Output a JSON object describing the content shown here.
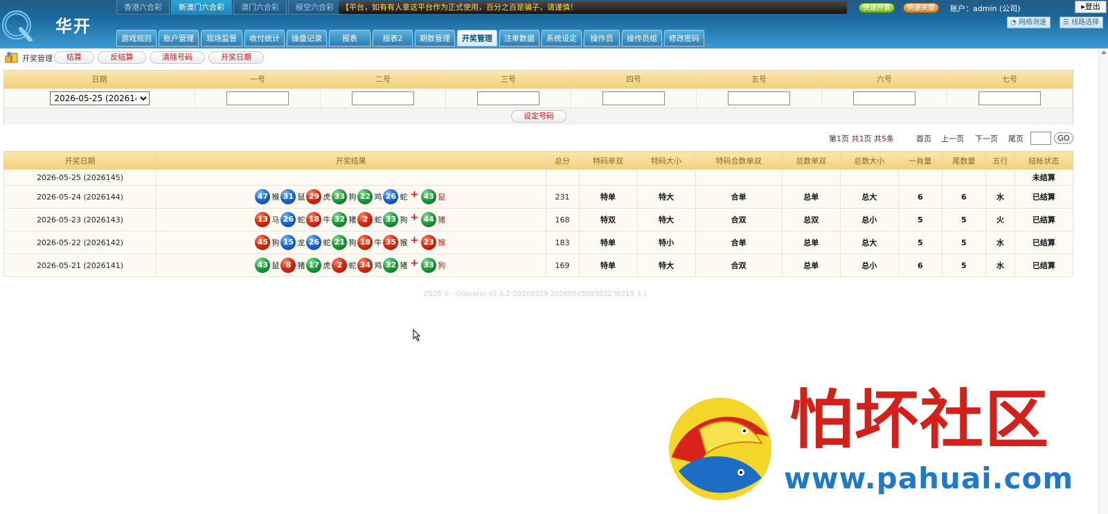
{
  "header": {
    "logo_text": "华开",
    "lottery_tabs": [
      {
        "label": "香港六合彩",
        "active": false
      },
      {
        "label": "新澳门六合彩",
        "active": true
      },
      {
        "label": "澳门六合彩",
        "active": false
      },
      {
        "label": "極空六合彩",
        "active": false
      }
    ],
    "marquee": "【平台，如有有人拿这平台作为正式使用，百分之百是骗子，请谨慎！",
    "quick_open": "快速开盘",
    "quick_close": "快速关盘",
    "account": "账户：admin (公司)",
    "logout": "登出",
    "net_speed": "网络测速",
    "line_select": "线路选择",
    "nav": [
      {
        "label": "游戏规则",
        "active": false
      },
      {
        "label": "账户管理",
        "active": false
      },
      {
        "label": "现场监督",
        "active": false
      },
      {
        "label": "收付统计",
        "active": false
      },
      {
        "label": "操盘记录",
        "active": false
      },
      {
        "label": "报表",
        "active": false
      },
      {
        "label": "报表2",
        "active": false
      },
      {
        "label": "期数管理",
        "active": false
      },
      {
        "label": "开奖管理",
        "active": true
      },
      {
        "label": "注单数据",
        "active": false
      },
      {
        "label": "系统设定",
        "active": false
      },
      {
        "label": "操作员",
        "active": false
      },
      {
        "label": "操作员组",
        "active": false
      },
      {
        "label": "修改密码",
        "active": false
      }
    ]
  },
  "toolbar": {
    "title": "开奖管理",
    "buttons": [
      "结算",
      "反结算",
      "清除号码",
      "开奖日期"
    ]
  },
  "form": {
    "headers": [
      "日期",
      "一号",
      "二号",
      "三号",
      "四号",
      "五号",
      "六号",
      "七号"
    ],
    "selected_date": "2026-05-25 (2026145)",
    "set_button": "设定号码"
  },
  "pager": {
    "prefix": "第",
    "page": "1",
    "mid1": "页 共",
    "pages": "1",
    "mid2": "页 共",
    "total": "5",
    "suffix": "条",
    "first": "首页",
    "prev": "上一页",
    "next": "下一页",
    "last": "尾页",
    "go": "GO"
  },
  "table": {
    "headers": [
      "开奖日期",
      "开奖结果",
      "总分",
      "特码单双",
      "特码大小",
      "特码合数单双",
      "总数单双",
      "总数大小",
      "一肖量",
      "尾数量",
      "五行",
      "结帐状态"
    ],
    "rows": [
      {
        "date": "2026-05-25 (2026145)",
        "balls": [],
        "total": "",
        "tm_ds": "",
        "tm_dx": "",
        "tm_hs": "",
        "zs_ds": "",
        "zs_dx": "",
        "yx": "",
        "ws": "",
        "wx": "",
        "status": "未结算"
      },
      {
        "date": "2026-05-24 (2026144)",
        "balls": [
          {
            "n": "47",
            "c": "blue",
            "z": "猴"
          },
          {
            "n": "31",
            "c": "blue",
            "z": "鼠"
          },
          {
            "n": "29",
            "c": "red",
            "z": "虎"
          },
          {
            "n": "33",
            "c": "green",
            "z": "狗"
          },
          {
            "n": "22",
            "c": "green",
            "z": "鸡"
          },
          {
            "n": "26",
            "c": "blue",
            "z": "蛇"
          },
          {
            "n": "43",
            "c": "green",
            "z": "鼠"
          }
        ],
        "total": "231",
        "tm_ds": "特单",
        "tm_dx": "特大",
        "tm_hs": "合单",
        "zs_ds": "总单",
        "zs_dx": "总大",
        "yx": "6",
        "ws": "6",
        "wx": "水",
        "status": "已结算"
      },
      {
        "date": "2026-05-23 (2026143)",
        "balls": [
          {
            "n": "13",
            "c": "red",
            "z": "马"
          },
          {
            "n": "26",
            "c": "blue",
            "z": "蛇"
          },
          {
            "n": "18",
            "c": "red",
            "z": "牛"
          },
          {
            "n": "32",
            "c": "green",
            "z": "猪"
          },
          {
            "n": "2",
            "c": "red",
            "z": "蛇"
          },
          {
            "n": "33",
            "c": "green",
            "z": "狗"
          },
          {
            "n": "44",
            "c": "green",
            "z": "猪"
          }
        ],
        "total": "168",
        "tm_ds": "特双",
        "tm_dx": "特大",
        "tm_hs": "合双",
        "zs_ds": "总双",
        "zs_dx": "总小",
        "yx": "5",
        "ws": "5",
        "wx": "火",
        "status": "已结算"
      },
      {
        "date": "2026-05-22 (2026142)",
        "balls": [
          {
            "n": "45",
            "c": "red",
            "z": "狗"
          },
          {
            "n": "15",
            "c": "blue",
            "z": "龙"
          },
          {
            "n": "26",
            "c": "blue",
            "z": "蛇"
          },
          {
            "n": "21",
            "c": "green",
            "z": "狗"
          },
          {
            "n": "18",
            "c": "red",
            "z": "牛"
          },
          {
            "n": "35",
            "c": "red",
            "z": "猴"
          },
          {
            "n": "23",
            "c": "red",
            "z": "猴"
          }
        ],
        "total": "183",
        "tm_ds": "特单",
        "tm_dx": "特小",
        "tm_hs": "合单",
        "zs_ds": "总单",
        "zs_dx": "总大",
        "yx": "5",
        "ws": "5",
        "wx": "水",
        "status": "已结算"
      },
      {
        "date": "2026-05-21 (2026141)",
        "balls": [
          {
            "n": "43",
            "c": "green",
            "z": "鼠"
          },
          {
            "n": "8",
            "c": "red",
            "z": "猪"
          },
          {
            "n": "17",
            "c": "green",
            "z": "虎"
          },
          {
            "n": "2",
            "c": "red",
            "z": "蛇"
          },
          {
            "n": "34",
            "c": "red",
            "z": "鸡"
          },
          {
            "n": "32",
            "c": "green",
            "z": "猪"
          },
          {
            "n": "33",
            "c": "green",
            "z": "狗"
          }
        ],
        "total": "169",
        "tm_ds": "特单",
        "tm_dx": "特大",
        "tm_hs": "合双",
        "zs_ds": "总单",
        "zs_dx": "总小",
        "yx": "6",
        "ws": "5",
        "wx": "水",
        "status": "已结算"
      }
    ]
  },
  "footer": "2026 ©        -Operator v2.6.2-20260329 20260505095832 W219 3 1",
  "watermark": {
    "title": "怕坏社区",
    "url": "www.pahuai.com"
  }
}
